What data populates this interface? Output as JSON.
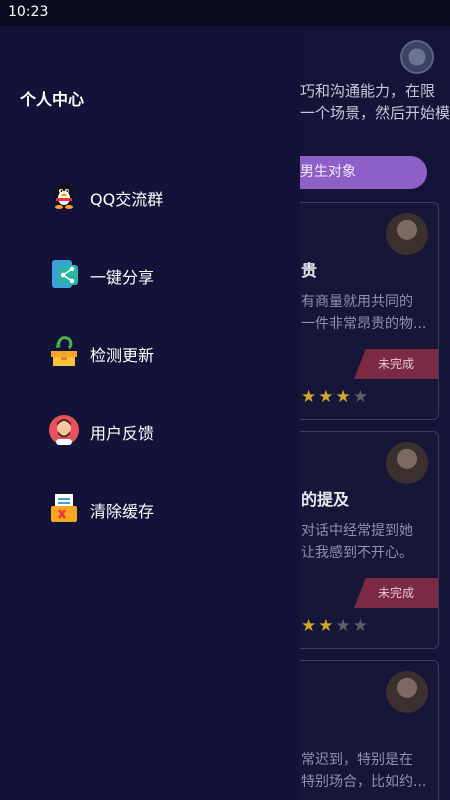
{
  "status_bar": {
    "time": "10:23"
  },
  "drawer": {
    "title": "个人中心",
    "items": [
      {
        "label": "QQ交流群",
        "icon": "qq-penguin-icon"
      },
      {
        "label": "一键分享",
        "icon": "share-icon"
      },
      {
        "label": "检测更新",
        "icon": "update-box-icon"
      },
      {
        "label": "用户反馈",
        "icon": "user-avatar-icon"
      },
      {
        "label": "清除缓存",
        "icon": "clear-cache-icon"
      }
    ]
  },
  "background": {
    "intro_line1": "巧和沟通能力，在限",
    "intro_line2": "一个场景，然后开始模",
    "tab_label": "男生对象",
    "cards": [
      {
        "title": "贵",
        "desc_line1": "有商量就用共同的",
        "desc_line2": "一件非常昂贵的物...",
        "status": "未完成",
        "rating": 3
      },
      {
        "title": "的提及",
        "desc_line1": "对话中经常提到她",
        "desc_line2": "让我感到不开心。",
        "status": "未完成",
        "rating": 2
      },
      {
        "title": "",
        "desc_line1": "常迟到，特别是在",
        "desc_line2": "特别场合，比如约..."
      }
    ]
  }
}
